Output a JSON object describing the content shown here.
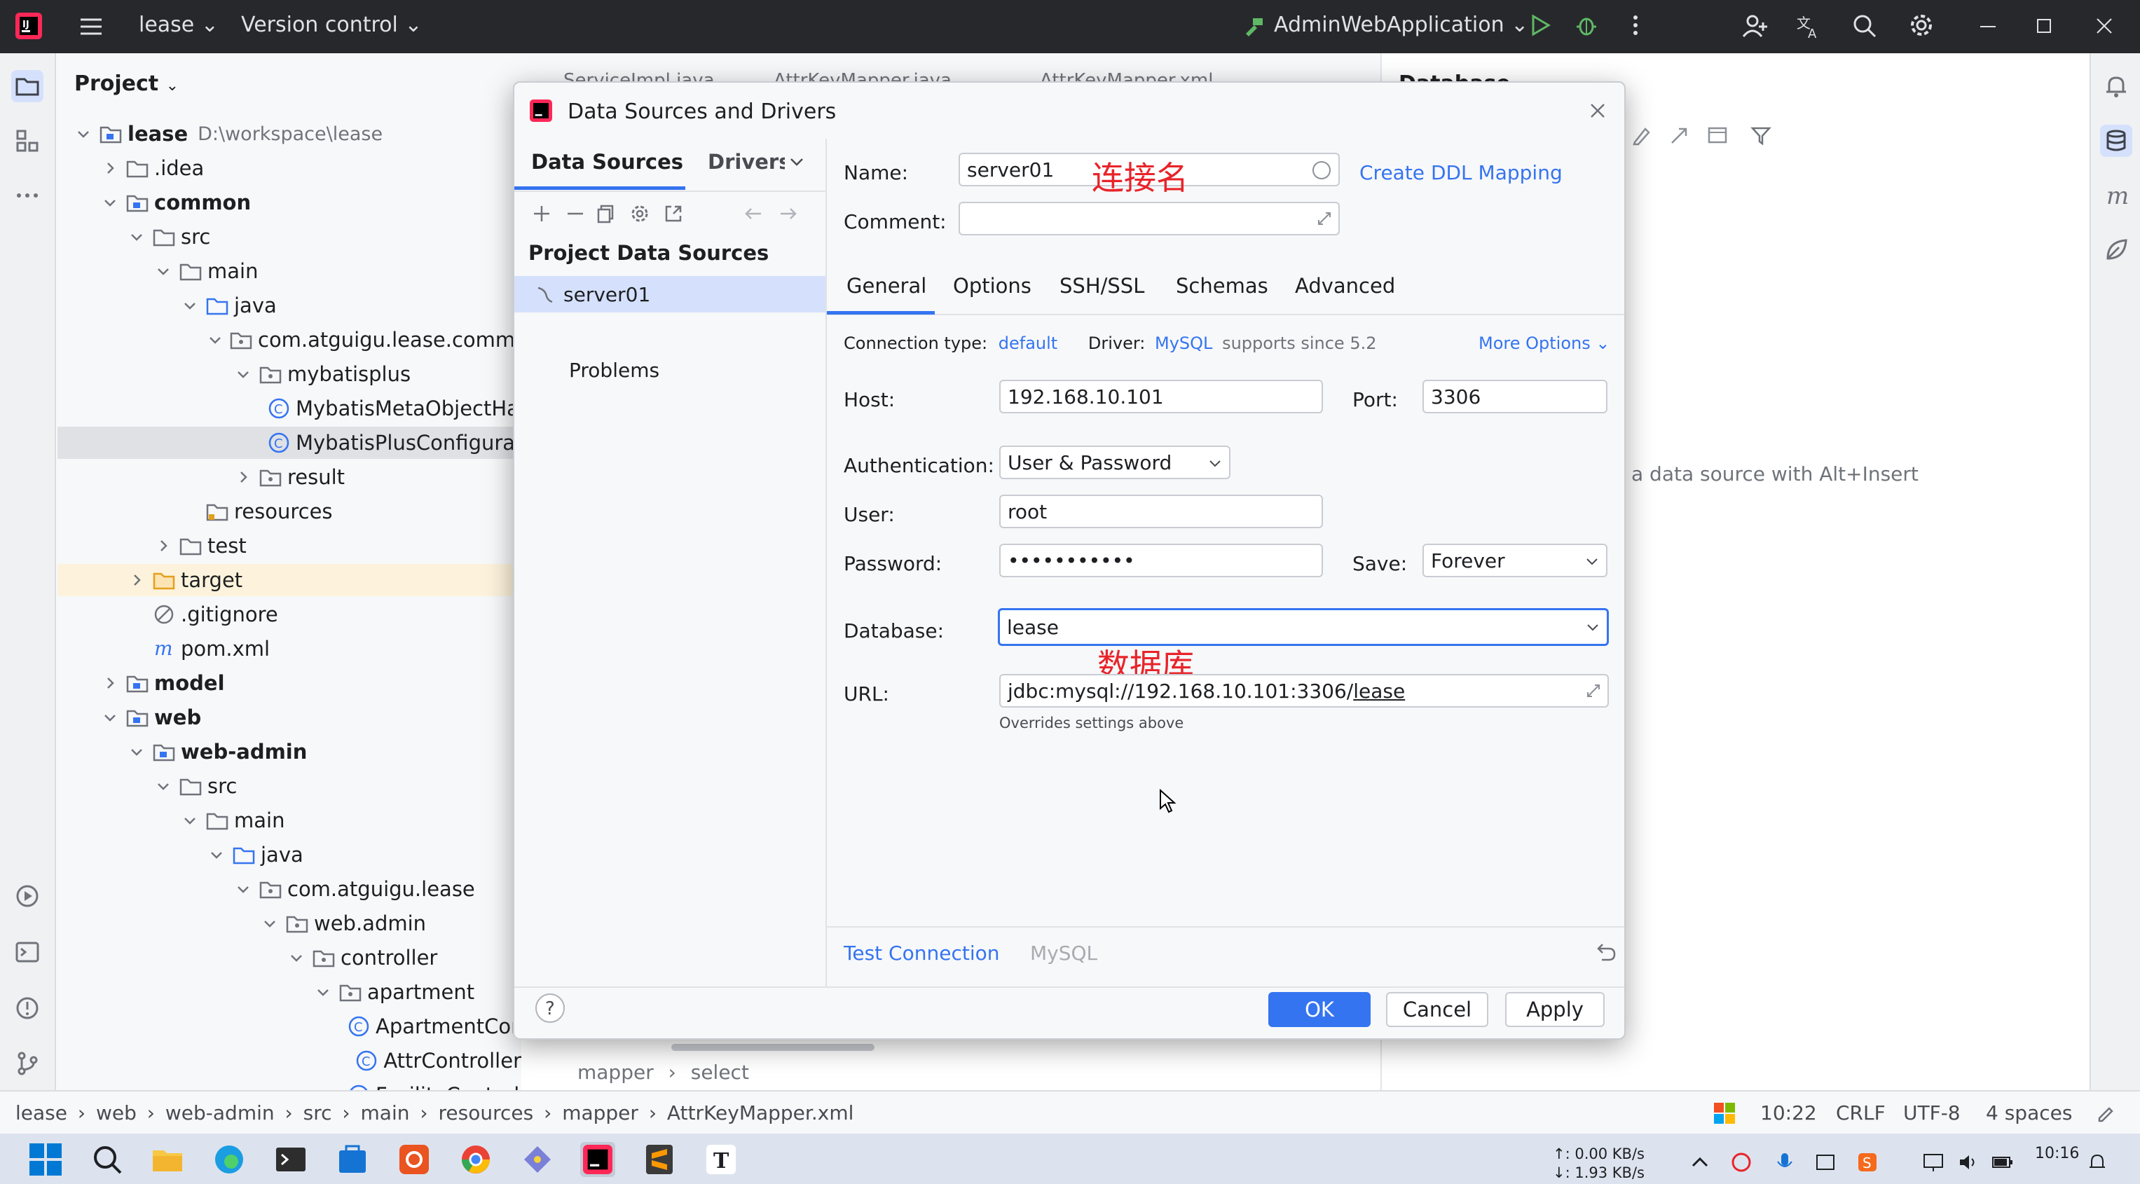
{
  "titlebar": {
    "project": "lease",
    "vcs": "Version control",
    "run_config": "AdminWebApplication"
  },
  "project_panel": {
    "title": "Project",
    "tree": [
      {
        "label": "lease",
        "extra": "D:\\workspace\\lease",
        "bold": true,
        "depth": 0,
        "chev": "down",
        "icon": "module"
      },
      {
        "label": ".idea",
        "depth": 1,
        "chev": "right",
        "icon": "folder"
      },
      {
        "label": "common",
        "bold": true,
        "depth": 1,
        "chev": "down",
        "icon": "module"
      },
      {
        "label": "src",
        "depth": 2,
        "chev": "down",
        "icon": "folder"
      },
      {
        "label": "main",
        "depth": 3,
        "chev": "down",
        "icon": "folder"
      },
      {
        "label": "java",
        "depth": 4,
        "chev": "down",
        "icon": "folder-src"
      },
      {
        "label": "com.atguigu.lease.common",
        "depth": 5,
        "chev": "down",
        "icon": "package"
      },
      {
        "label": "mybatisplus",
        "depth": 6,
        "chev": "down",
        "icon": "package"
      },
      {
        "label": "MybatisMetaObjectHandler",
        "depth": 7,
        "chev": "none",
        "icon": "class"
      },
      {
        "label": "MybatisPlusConfiguration",
        "depth": 7,
        "chev": "none",
        "icon": "class",
        "selected": true
      },
      {
        "label": "result",
        "depth": 6,
        "chev": "right",
        "icon": "package"
      },
      {
        "label": "resources",
        "depth": 4,
        "chev": "none",
        "icon": "folder-res"
      },
      {
        "label": "test",
        "depth": 3,
        "chev": "right",
        "icon": "folder"
      },
      {
        "label": "target",
        "depth": 2,
        "chev": "right",
        "icon": "folder-excl",
        "highlight": true
      },
      {
        "label": ".gitignore",
        "depth": 2,
        "chev": "none",
        "icon": "ignore"
      },
      {
        "label": "pom.xml",
        "depth": 2,
        "chev": "none",
        "icon": "maven"
      },
      {
        "label": "model",
        "bold": true,
        "depth": 1,
        "chev": "right",
        "icon": "module"
      },
      {
        "label": "web",
        "bold": true,
        "depth": 1,
        "chev": "down",
        "icon": "module"
      },
      {
        "label": "web-admin",
        "bold": true,
        "depth": 2,
        "chev": "down",
        "icon": "module"
      },
      {
        "label": "src",
        "depth": 3,
        "chev": "down",
        "icon": "folder"
      },
      {
        "label": "main",
        "depth": 4,
        "chev": "down",
        "icon": "folder"
      },
      {
        "label": "java",
        "depth": 5,
        "chev": "down",
        "icon": "folder-src"
      },
      {
        "label": "com.atguigu.lease",
        "depth": 6,
        "chev": "down",
        "icon": "package"
      },
      {
        "label": "web.admin",
        "depth": 7,
        "chev": "down",
        "icon": "package"
      },
      {
        "label": "controller",
        "depth": 8,
        "chev": "down",
        "icon": "package"
      },
      {
        "label": "apartment",
        "depth": 9,
        "chev": "down",
        "icon": "package"
      },
      {
        "label": "ApartmentController",
        "depth": 10,
        "chev": "none",
        "icon": "class"
      },
      {
        "label": "AttrController",
        "depth": 10,
        "chev": "none",
        "icon": "class"
      },
      {
        "label": "FacilityController",
        "depth": 10,
        "chev": "none",
        "icon": "class"
      }
    ]
  },
  "editor": {
    "tabs": [
      "ServiceImpl.java",
      "AttrKeyMapper.java",
      "AttrKeyMapper.xml"
    ],
    "breadcrumb": [
      "mapper",
      "select"
    ]
  },
  "database_panel": {
    "title": "Database",
    "hint": "a data source with Alt+Insert"
  },
  "dialog": {
    "title": "Data Sources and Drivers",
    "left_tabs": [
      "Data Sources",
      "Drivers"
    ],
    "section": "Project Data Sources",
    "sources": [
      "server01"
    ],
    "problems": "Problems",
    "name_label": "Name:",
    "name_value": "server01",
    "create_ddl": "Create DDL Mapping",
    "comment_label": "Comment:",
    "comment_value": "",
    "tabs": [
      "General",
      "Options",
      "SSH/SSL",
      "Schemas",
      "Advanced"
    ],
    "active_tab": "General",
    "conn_type_label": "Connection type:",
    "conn_type_value": "default",
    "driver_label": "Driver:",
    "driver_value": "MySQL",
    "driver_note": "supports since 5.2",
    "more_options": "More Options",
    "host_label": "Host:",
    "host_value": "192.168.10.101",
    "port_label": "Port:",
    "port_value": "3306",
    "auth_label": "Authentication:",
    "auth_value": "User & Password",
    "user_label": "User:",
    "user_value": "root",
    "password_label": "Password:",
    "password_value": "•••••••••••",
    "save_label": "Save:",
    "save_value": "Forever",
    "database_label": "Database:",
    "database_value": "lease",
    "url_label": "URL:",
    "url_prefix": "jdbc:mysql://192.168.10.101:3306/",
    "url_db": "lease",
    "url_note": "Overrides settings above",
    "test_connection": "Test Connection",
    "driver_footer": "MySQL",
    "ok": "OK",
    "cancel": "Cancel",
    "apply": "Apply",
    "annotation_name": "连接名",
    "annotation_db": "数据库"
  },
  "statusbar": {
    "path": [
      "lease",
      "web",
      "web-admin",
      "src",
      "main",
      "resources",
      "mapper",
      "AttrKeyMapper.xml"
    ],
    "position": "10:22",
    "line_sep": "CRLF",
    "encoding": "UTF-8",
    "indent": "4 spaces"
  },
  "taskbar": {
    "net_up": "↑: 0.00 KB/s",
    "net_down": "↓: 1.93 KB/s",
    "time": "10:16"
  },
  "colors": {
    "accent": "#3574f0",
    "titlebar": "#27282c",
    "annotation": "#e8242a",
    "selection": "#d5e1fc"
  }
}
